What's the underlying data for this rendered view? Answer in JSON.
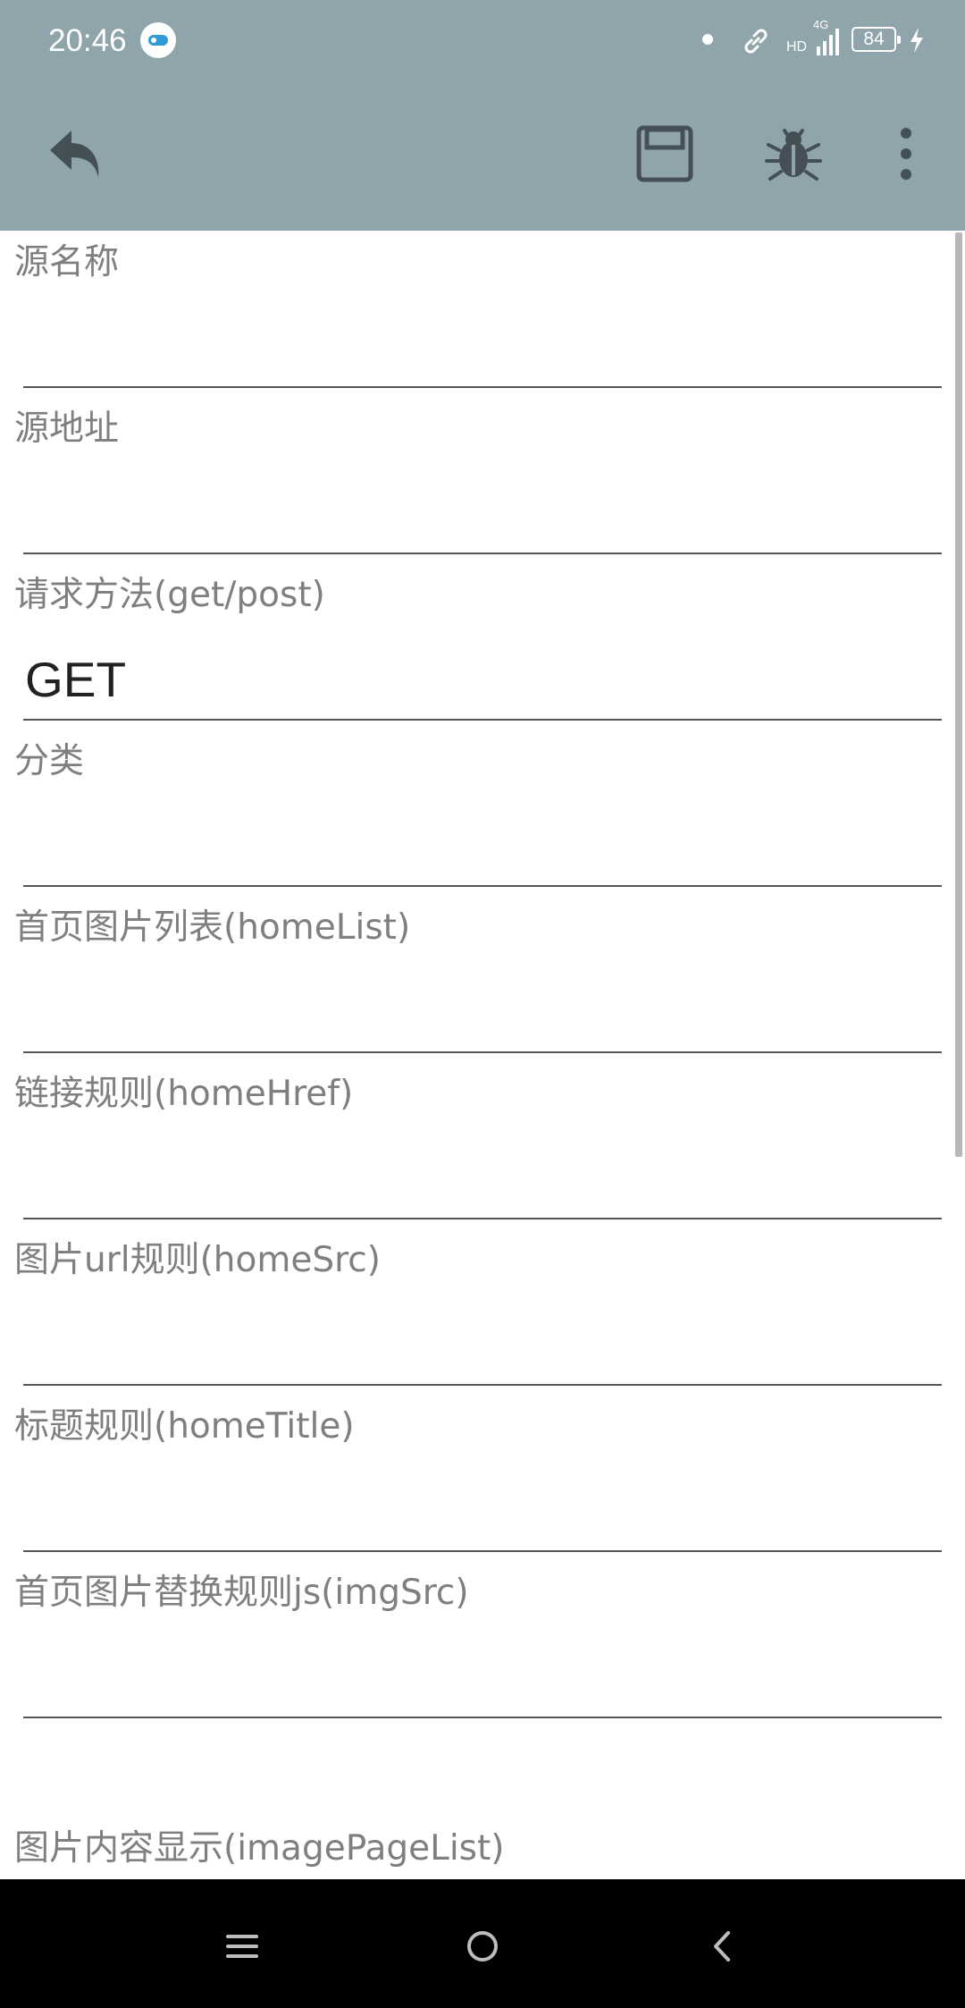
{
  "status_bar": {
    "time": "20:46",
    "network": "4G",
    "hd": "HD",
    "battery": "84",
    "icons": [
      "toggle-icon",
      "notification-dot-icon",
      "link-icon",
      "signal-icon",
      "battery-icon",
      "charging-icon"
    ]
  },
  "toolbar": {
    "background": "#90a4ab",
    "icons": [
      "back-icon",
      "save-icon",
      "debug-bug-icon",
      "more-vertical-icon"
    ]
  },
  "form": {
    "fields": [
      {
        "label": "源名称",
        "value": ""
      },
      {
        "label": "源地址",
        "value": ""
      },
      {
        "label": "请求方法(get/post)",
        "value": "GET"
      },
      {
        "label": "分类",
        "value": ""
      },
      {
        "label": "首页图片列表(homeList)",
        "value": ""
      },
      {
        "label": "链接规则(homeHref)",
        "value": ""
      },
      {
        "label": "图片url规则(homeSrc)",
        "value": ""
      },
      {
        "label": "标题规则(homeTitle)",
        "value": ""
      },
      {
        "label": "首页图片替换规则js(imgSrc)",
        "value": ""
      },
      {
        "label": "图片内容显示(imagePageList)",
        "value": ""
      }
    ]
  },
  "nav_bar": {
    "icons": [
      "menu-icon",
      "home-circle-icon",
      "back-chevron-icon"
    ]
  }
}
